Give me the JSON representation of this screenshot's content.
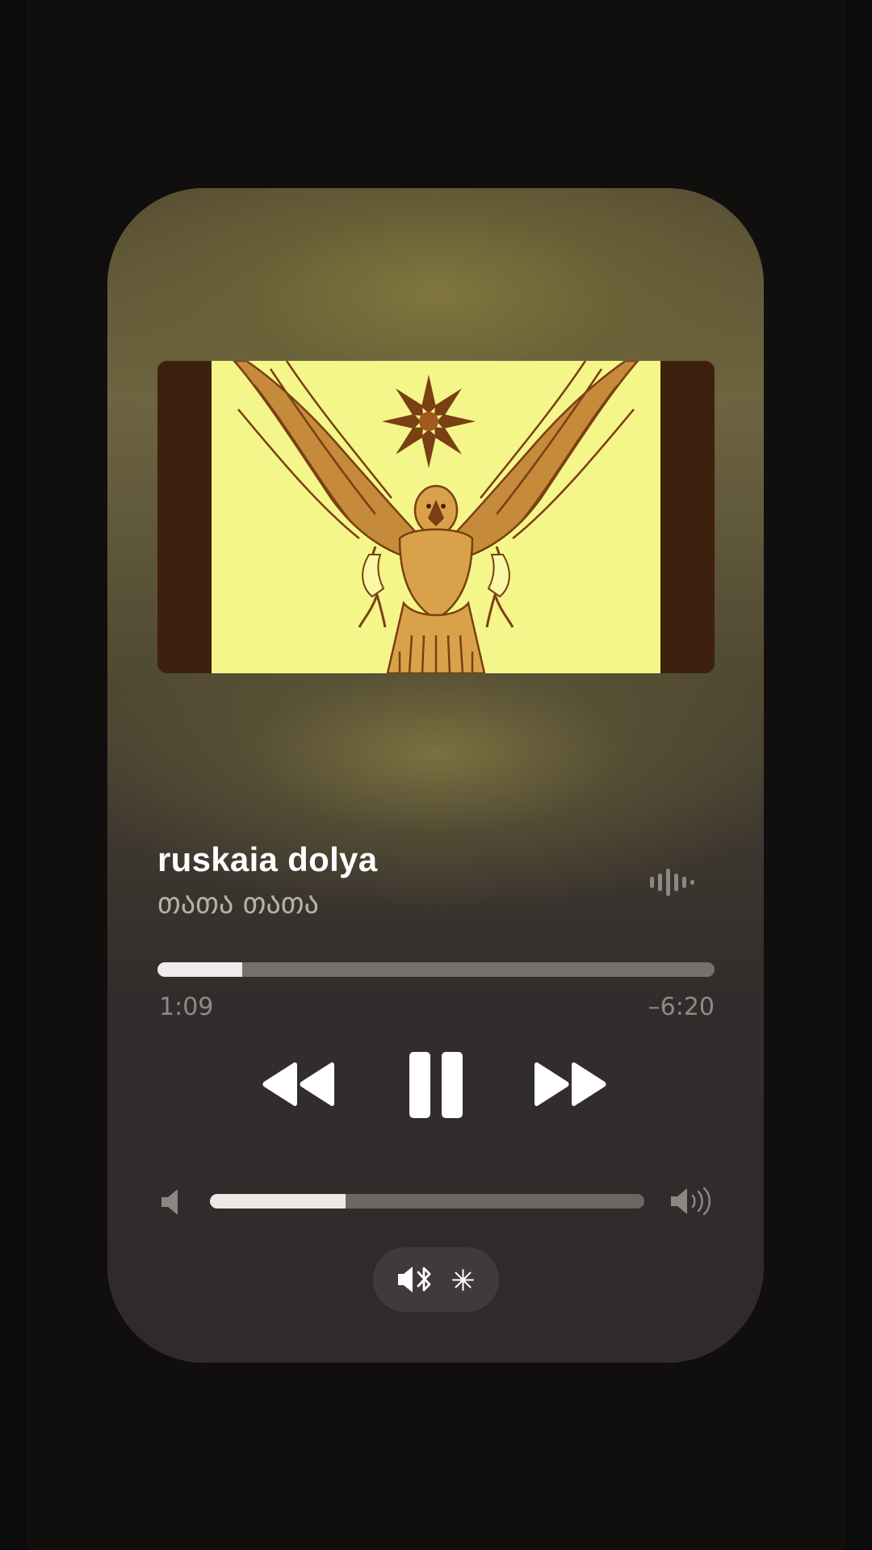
{
  "player": {
    "title": "ruskaia dolya",
    "artist": "თათა თათა",
    "time_elapsed": "1:09",
    "time_remaining": "–6:20",
    "progress_fraction": 0.152,
    "volume_fraction": 0.313
  },
  "icons": {
    "waveform": "waveform-icon",
    "rewind": "rewind-icon",
    "pause": "pause-icon",
    "forward": "fast-forward-icon",
    "volume_min": "speaker-low-icon",
    "volume_max": "speaker-high-icon",
    "route": "bluetooth-speaker-icon"
  },
  "colors": {
    "card_bg": "#302a2a",
    "art_yellow": "#f4f68a",
    "art_brown": "#3d210e",
    "art_ink": "#8a4e1c",
    "accent_white": "#ffffff"
  }
}
